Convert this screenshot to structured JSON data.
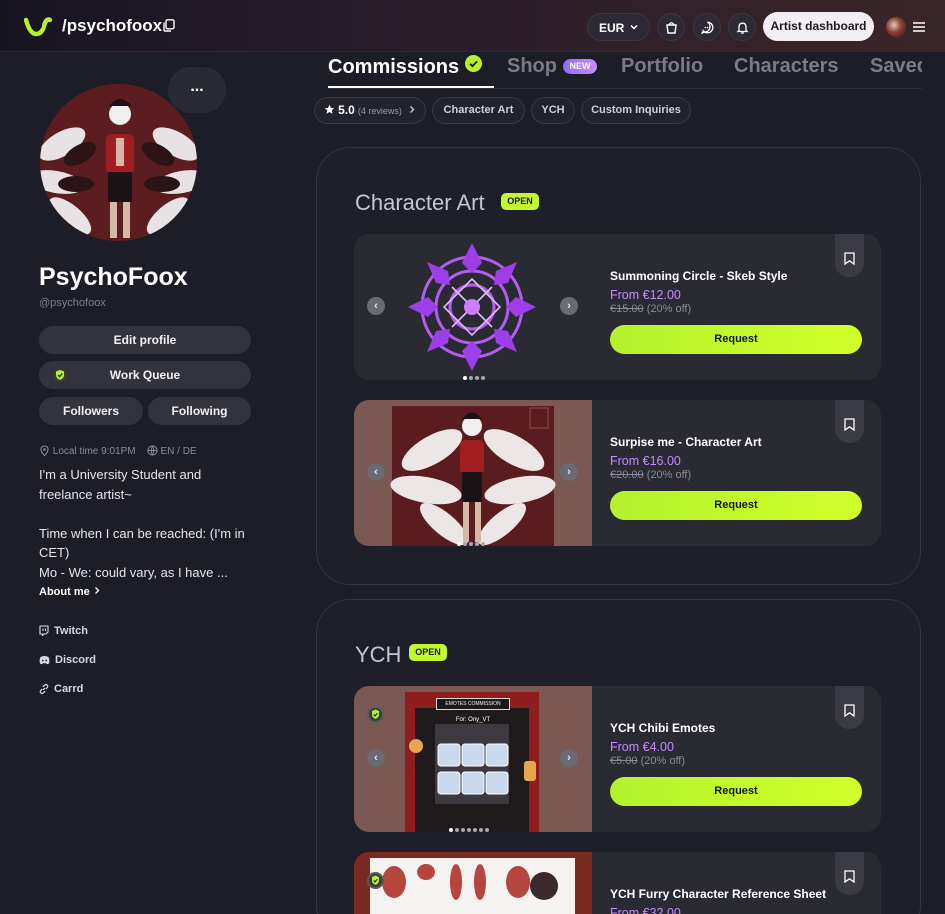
{
  "header": {
    "handle": "/psychofoox",
    "currency": "EUR",
    "dashboard_label": "Artist dashboard",
    "icons": [
      "logo-icon",
      "copy-icon",
      "chevron-down-icon",
      "bag-icon",
      "chat-icon",
      "bell-icon",
      "avatar",
      "menu-icon"
    ]
  },
  "profile": {
    "more_label": "...",
    "name": "PsychoFoox",
    "username": "@psychofoox",
    "edit_label": "Edit profile",
    "work_queue_label": "Work Queue",
    "followers_label": "Followers",
    "following_label": "Following",
    "local_time": "Local time 9:01PM",
    "languages": "EN / DE",
    "bio": "I'm a University Student and\nfreelance artist~\n\nTime when I can be reached: (I'm in\nCET)\nMo - We: could vary, as I have ...",
    "about_label": "About me",
    "links": [
      {
        "label": "Twitch",
        "icon": "twitch-icon"
      },
      {
        "label": "Discord",
        "icon": "discord-icon"
      },
      {
        "label": "Carrd",
        "icon": "link-icon"
      }
    ]
  },
  "tabs": [
    {
      "label": "Commissions",
      "active": true
    },
    {
      "label": "Shop",
      "badge": "NEW"
    },
    {
      "label": "Portfolio"
    },
    {
      "label": "Characters"
    },
    {
      "label": "Saved"
    }
  ],
  "filters": {
    "rating": "5.0",
    "reviews": "(4 reviews)",
    "chips": [
      "Character Art",
      "YCH",
      "Custom Inquiries"
    ]
  },
  "sections": [
    {
      "title": "Character Art",
      "status": "OPEN",
      "cards": [
        {
          "title": "Summoning Circle - Skeb Style",
          "price": "From €12.00",
          "old_price": "€15.00",
          "discount": "(20% off)",
          "button": "Request"
        },
        {
          "title": "Surpise me - Character Art",
          "price": "From €16.00",
          "old_price": "€20.00",
          "discount": "(20% off)",
          "button": "Request"
        }
      ]
    },
    {
      "title": "YCH",
      "status": "OPEN",
      "cards": [
        {
          "title": "YCH Chibi Emotes",
          "price": "From €4.00",
          "old_price": "€5.00",
          "discount": "(20% off)",
          "button": "Request",
          "image_text": "EMOTES COMMISSION",
          "image_subtext": "For: Ony_VT"
        },
        {
          "title": "YCH Furry Character Reference Sheet",
          "price": "From €32.00"
        }
      ]
    }
  ],
  "colors": {
    "accent_green": "#c2f82d",
    "price_purple": "#c48cff",
    "background": "#1d1d27"
  }
}
